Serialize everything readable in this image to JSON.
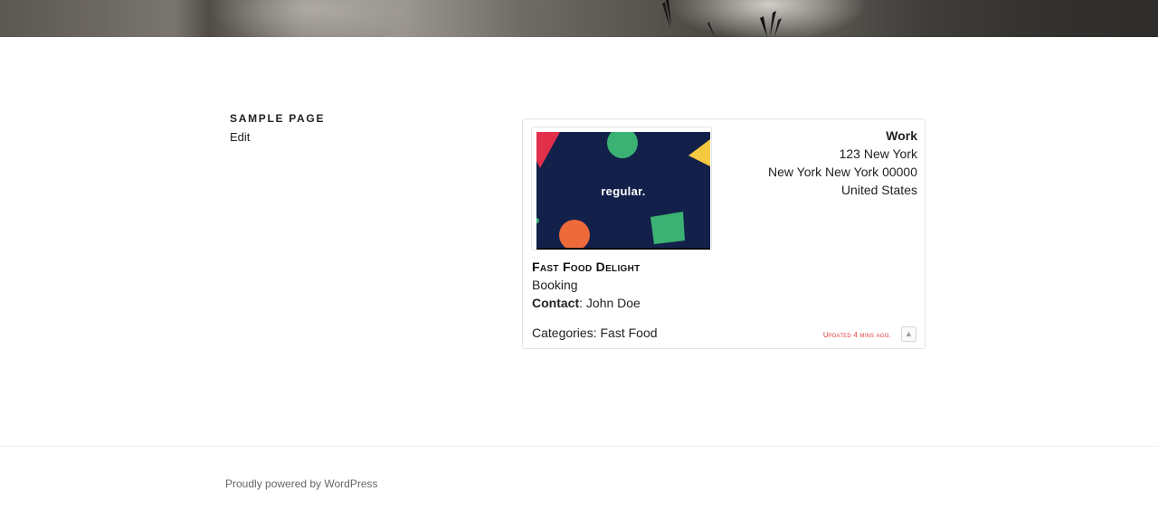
{
  "page": {
    "title": "Sample Page",
    "edit_label": "Edit"
  },
  "listing": {
    "logo_text": "regular.",
    "address": {
      "type": "Work",
      "line1": "123 New York",
      "line2": "New York New York 00000",
      "country": "United States"
    },
    "name": "Fast Food Delight",
    "subtitle": "Booking",
    "contact_label": "Contact",
    "contact_name": ": John Doe",
    "categories": "Categories: Fast Food",
    "updated": "Updated 4 mins ago.",
    "top_icon": "▲"
  },
  "footer": {
    "credit": "Proudly powered by WordPress"
  }
}
